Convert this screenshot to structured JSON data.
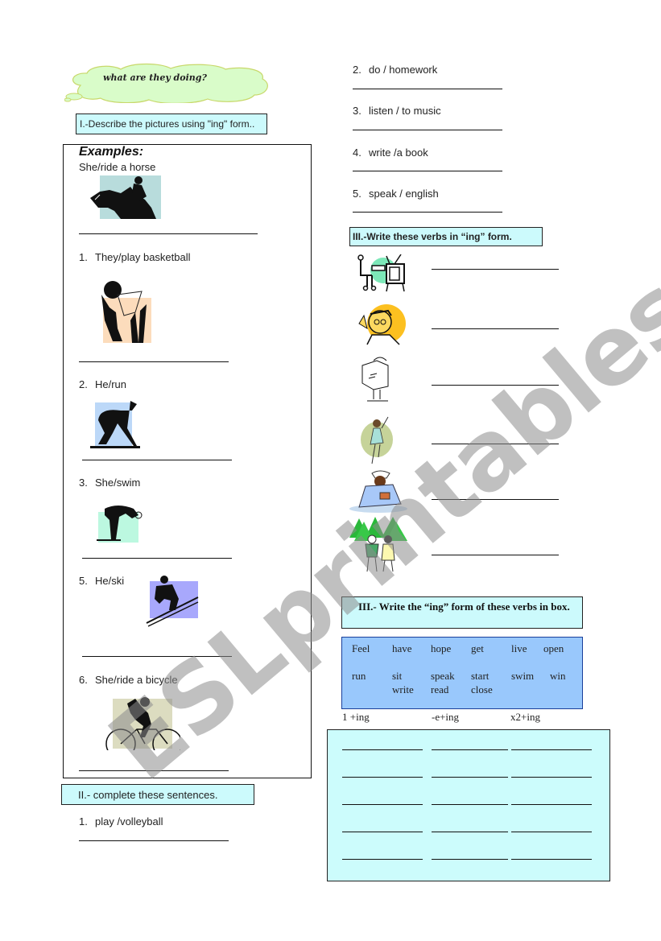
{
  "header": {
    "cloud_title": "what are they doing?"
  },
  "section1": {
    "title": "I.-Describe  the pictures using \"ing\" form..",
    "examples_label": "Examples:",
    "example": {
      "prompt": "She/ride a horse",
      "picture": "horse-rider-icon"
    },
    "items": [
      {
        "number": "1.",
        "prompt": "They/play basketball",
        "picture": "basketball-player-icon"
      },
      {
        "number": "2.",
        "prompt": "He/run",
        "picture": "runner-icon"
      },
      {
        "number": "3.",
        "prompt": "She/swim",
        "picture": "swimmer-icon"
      },
      {
        "number": "5.",
        "prompt": "He/ski",
        "picture": "skier-icon"
      },
      {
        "number": "6.",
        "prompt": "She/ride a bicycle",
        "picture": "cyclist-icon"
      }
    ]
  },
  "section2": {
    "title": "II.- complete these sentences.",
    "items": [
      {
        "number": "1.",
        "prompt": "play /volleyball"
      },
      {
        "number": "2.",
        "prompt": "do / homework"
      },
      {
        "number": "3.",
        "prompt": "listen / to music"
      },
      {
        "number": "4.",
        "prompt": "write  /a  book"
      },
      {
        "number": "5.",
        "prompt": "speak / english"
      }
    ]
  },
  "section3a": {
    "title": "III.-Write these verbs in  “ing”  form.",
    "pictures": [
      "watch-tv-icon",
      "talk-phone-icon",
      "read-newspaper-icon",
      "dance-icon",
      "read-book-icon",
      "walk-forest-icon"
    ]
  },
  "section3b": {
    "title": "III.- Write the “ing” form of these verbs in box.",
    "verbs_row1": [
      "Feel",
      "have",
      "hope",
      "get",
      "live",
      "open"
    ],
    "verbs_row2": [
      "run",
      "sit",
      "speak",
      "start",
      "swim",
      "win"
    ],
    "verbs_row3": [
      "write",
      "read",
      "close"
    ],
    "categories": [
      "1 +ing",
      "-e+ing",
      "x2+ing"
    ],
    "answer_rows": 5
  },
  "watermark": "ESLprintables.com",
  "colors": {
    "cyan_box": "#ccfafc",
    "verb_box": "#99c8fc",
    "cloud": "#d8fcc8"
  }
}
